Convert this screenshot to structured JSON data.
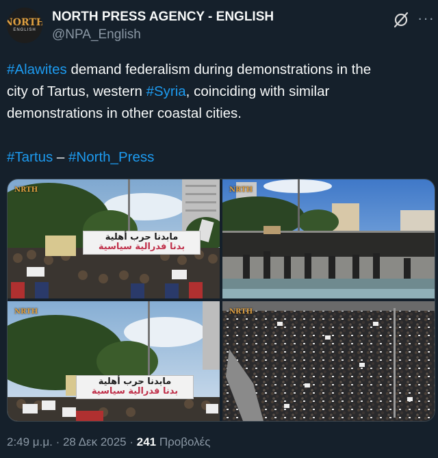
{
  "account": {
    "name": "NORTH PRESS AGENCY - ENGLISH",
    "handle": "@NPA_English",
    "avatar_logo": "NORTH",
    "avatar_logo_sub": "ENGLISH"
  },
  "icons": {
    "grok": "grok-icon",
    "more": "more-options-icon"
  },
  "tweet": {
    "line1_tag": "#Alawites",
    "line1_text": " demand federalism during demonstrations in the",
    "line2_text_a": "city of Tartus, western ",
    "line2_tag": "#Syria",
    "line2_text_b": ", coinciding with similar",
    "line3_text": "demonstrations in other coastal cities.",
    "hashtag_tartus": "#Tartus",
    "dash": " – ",
    "hashtag_northpress": "#North_Press"
  },
  "media": {
    "watermark": "NRTH",
    "banner_line1": "مابدنا حرب أهلية",
    "banner_line2": "بدنا فدرالية سياسية"
  },
  "footer": {
    "time": "2:49 μ.μ.",
    "sep1": " · ",
    "date": "28 Δεκ 2025",
    "sep2": " · ",
    "views_count": "241",
    "views_label": " Προβολές"
  },
  "colors": {
    "background": "#15202b",
    "link": "#1d9bf0",
    "muted": "#8b98a5",
    "text": "#f7f9f9"
  }
}
